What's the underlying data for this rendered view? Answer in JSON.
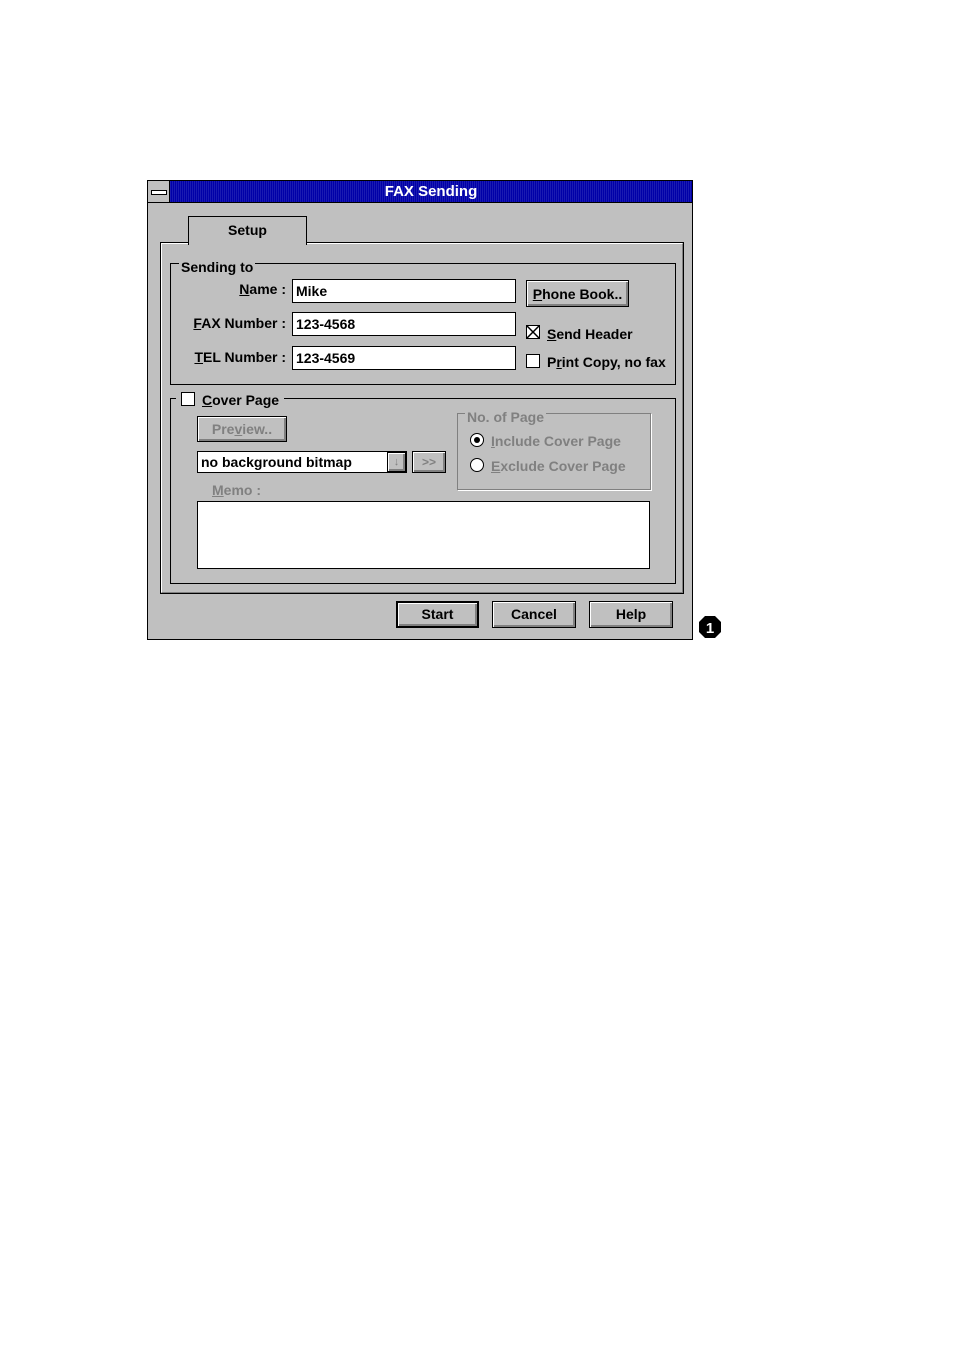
{
  "window": {
    "title": "FAX Sending"
  },
  "tabs": [
    {
      "label": "Setup"
    }
  ],
  "sending_to": {
    "legend": "Sending to",
    "name_label": "Name :",
    "name_value": "Mike",
    "fax_label": "FAX Number :",
    "fax_value": "123-4568",
    "tel_label": "TEL Number :",
    "tel_value": "123-4569",
    "phone_book_label": "Phone Book..",
    "send_header_label": "Send Header",
    "send_header_checked": true,
    "print_copy_label": "Print Copy, no fax",
    "print_copy_checked": false
  },
  "cover_page": {
    "label": "Cover Page",
    "checked": false,
    "preview_label": "Preview..",
    "background_select_value": "no background bitmap",
    "browse_label": ">>",
    "memo_label": "Memo :",
    "memo_value": "",
    "no_of_page": {
      "legend": "No. of Page",
      "include_label": "Include Cover Page",
      "exclude_label": "Exclude Cover Page",
      "selected": "Include Cover Page"
    }
  },
  "buttons": {
    "start": "Start",
    "cancel": "Cancel",
    "help": "Help"
  },
  "annotation_marker": "1"
}
